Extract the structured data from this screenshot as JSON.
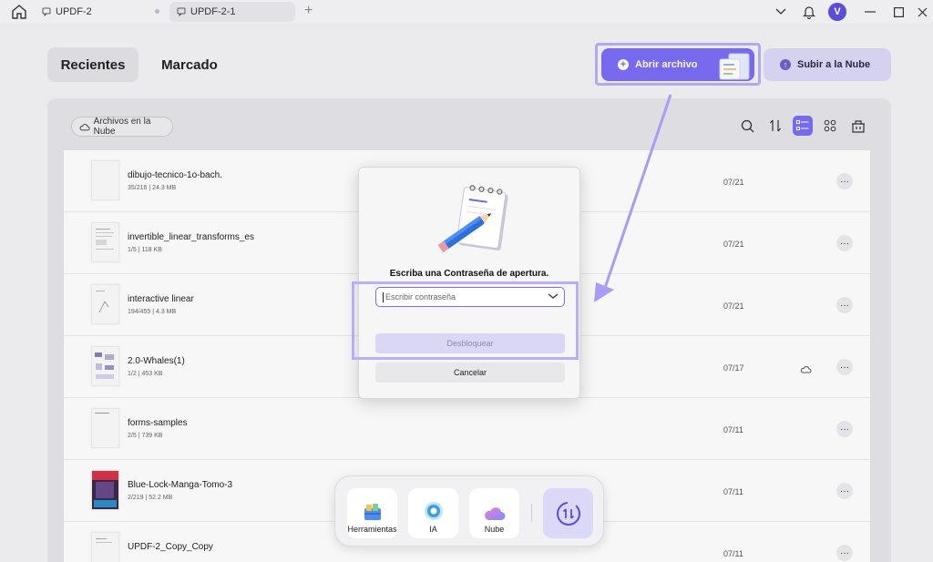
{
  "titlebar": {
    "tabs": [
      {
        "label": "UPDF-2"
      },
      {
        "label": "UPDF-2-1"
      }
    ],
    "avatar_initial": "V"
  },
  "top_tabs": {
    "recent": "Recientes",
    "marked": "Marcado"
  },
  "actions": {
    "open_file": "Abrir archivo",
    "upload_cloud": "Subir a la Nube"
  },
  "filter": {
    "cloud_files": "Archivos en la Nube"
  },
  "files": [
    {
      "name": "dibujo-tecnico-1o-bach.",
      "meta": "35/216 | 24.3 MB",
      "date": "07/21",
      "cloud": false
    },
    {
      "name": "invertible_linear_transforms_es",
      "meta": "1/5 | 118 KB",
      "date": "07/21",
      "cloud": false
    },
    {
      "name": "interactive linear",
      "meta": "194/455 | 4.3 MB",
      "date": "07/21",
      "cloud": false
    },
    {
      "name": "2.0-Whales(1)",
      "meta": "1/2 | 453 KB",
      "date": "07/17",
      "cloud": true
    },
    {
      "name": "forms-samples",
      "meta": "2/5 | 739 KB",
      "date": "07/11",
      "cloud": false
    },
    {
      "name": "Blue-Lock-Manga-Tomo-3",
      "meta": "2/219 | 52.2 MB",
      "date": "07/11",
      "cloud": false
    },
    {
      "name": "UPDF-2_Copy_Copy",
      "meta": "",
      "date": "07/11",
      "cloud": false
    }
  ],
  "more_label": "···",
  "dialog": {
    "title": "Escriba una Contraseña de apertura.",
    "password_placeholder": "Escribir contraseña",
    "unlock": "Desbloquear",
    "cancel": "Cancelar"
  },
  "dock": {
    "tools": "Herramientas",
    "ai": "IA",
    "cloud": "Nube"
  },
  "colors": {
    "accent": "#7b6ef6",
    "highlight": "#b9aef7"
  }
}
